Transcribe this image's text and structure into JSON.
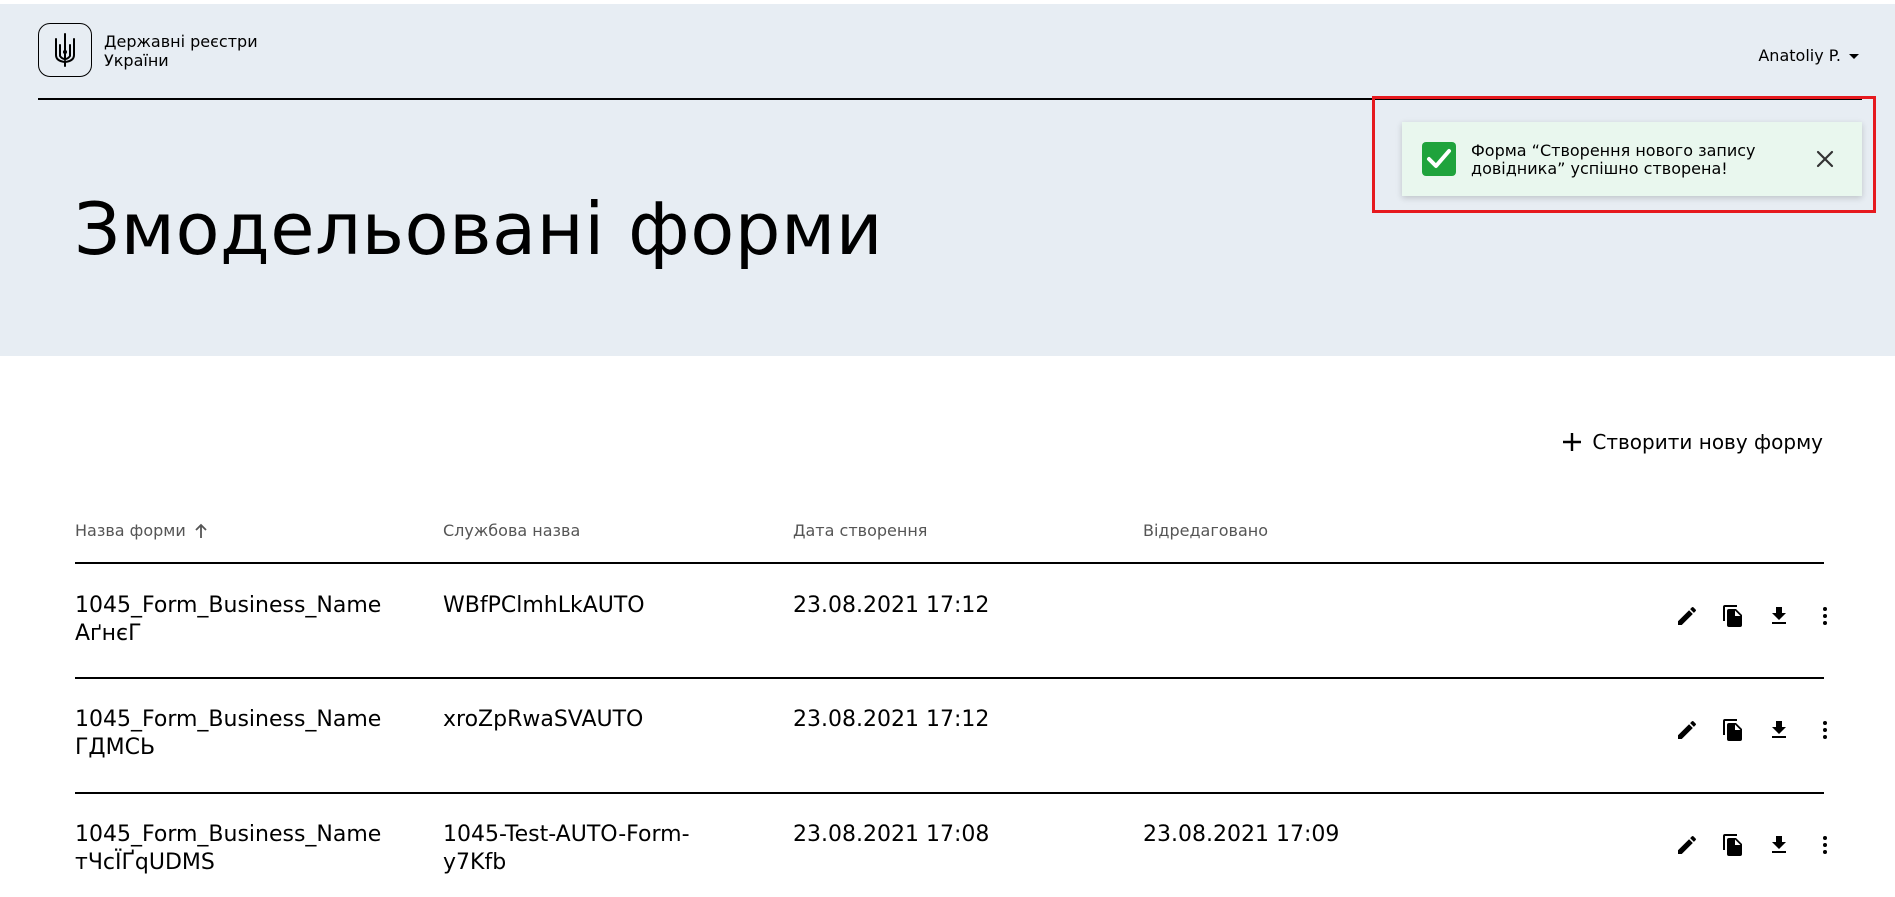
{
  "header": {
    "brand_line1": "Державні реєстри",
    "brand_line2": "України",
    "user_name": "Anatoliy P."
  },
  "page": {
    "title": "Змодельовані форми"
  },
  "toast": {
    "line1": "Форма “Створення нового запису",
    "line2": "довідника” успішно створена!",
    "status_color": "#1fa33c"
  },
  "toolbar": {
    "create_label": "Створити нову форму"
  },
  "table": {
    "columns": [
      "Назва форми",
      "Службова назва",
      "Дата створення",
      "Відредаговано"
    ],
    "sort_icon": "arrow-up-icon",
    "rows": [
      {
        "name1": "1045_Form_Business_Name",
        "name2": "АґнєГ",
        "service1": "WBfPClmhLkAUTO",
        "service2": "",
        "created": "23.08.2021 17:12",
        "edited": ""
      },
      {
        "name1": "1045_Form_Business_Name",
        "name2": "ГДМСЬ",
        "service1": "xroZpRwaSVAUTO",
        "service2": "",
        "created": "23.08.2021 17:12",
        "edited": ""
      },
      {
        "name1": "1045_Form_Business_Name",
        "name2": "тЧсЇҐqUDMS",
        "service1": "1045-Test-AUTO-Form-",
        "service2": "y7Kfb",
        "created": "23.08.2021 17:08",
        "edited": "23.08.2021 17:09"
      }
    ],
    "row_actions": [
      "pencil-icon",
      "copy-icon",
      "download-icon",
      "more-vertical-icon"
    ]
  }
}
